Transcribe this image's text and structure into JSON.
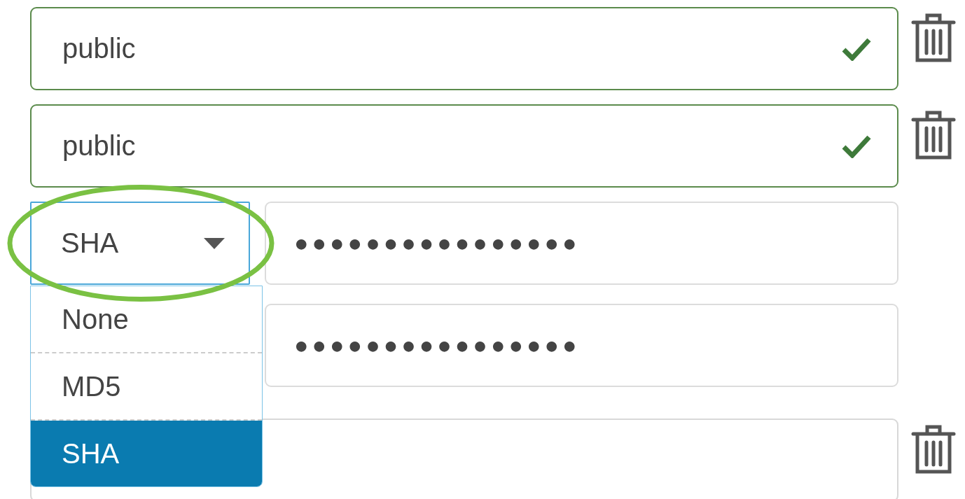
{
  "rows": [
    {
      "kind": "text",
      "value": "public",
      "valid": true,
      "deletable": true
    },
    {
      "kind": "text",
      "value": "public",
      "valid": true,
      "deletable": true
    },
    {
      "kind": "auth",
      "select": {
        "value": "SHA",
        "expanded": true,
        "options": [
          {
            "label": "None",
            "selected": false
          },
          {
            "label": "MD5",
            "selected": false
          },
          {
            "label": "SHA",
            "selected": true
          }
        ]
      },
      "password": "●●●●●●●●●●●●●●●●",
      "deletable": false
    },
    {
      "kind": "password",
      "password": "●●●●●●●●●●●●●●●●",
      "deletable": false
    },
    {
      "kind": "text",
      "valid": false,
      "deletable": true
    }
  ],
  "annotation": {
    "kind": "ellipse",
    "color": "#7ac143"
  }
}
